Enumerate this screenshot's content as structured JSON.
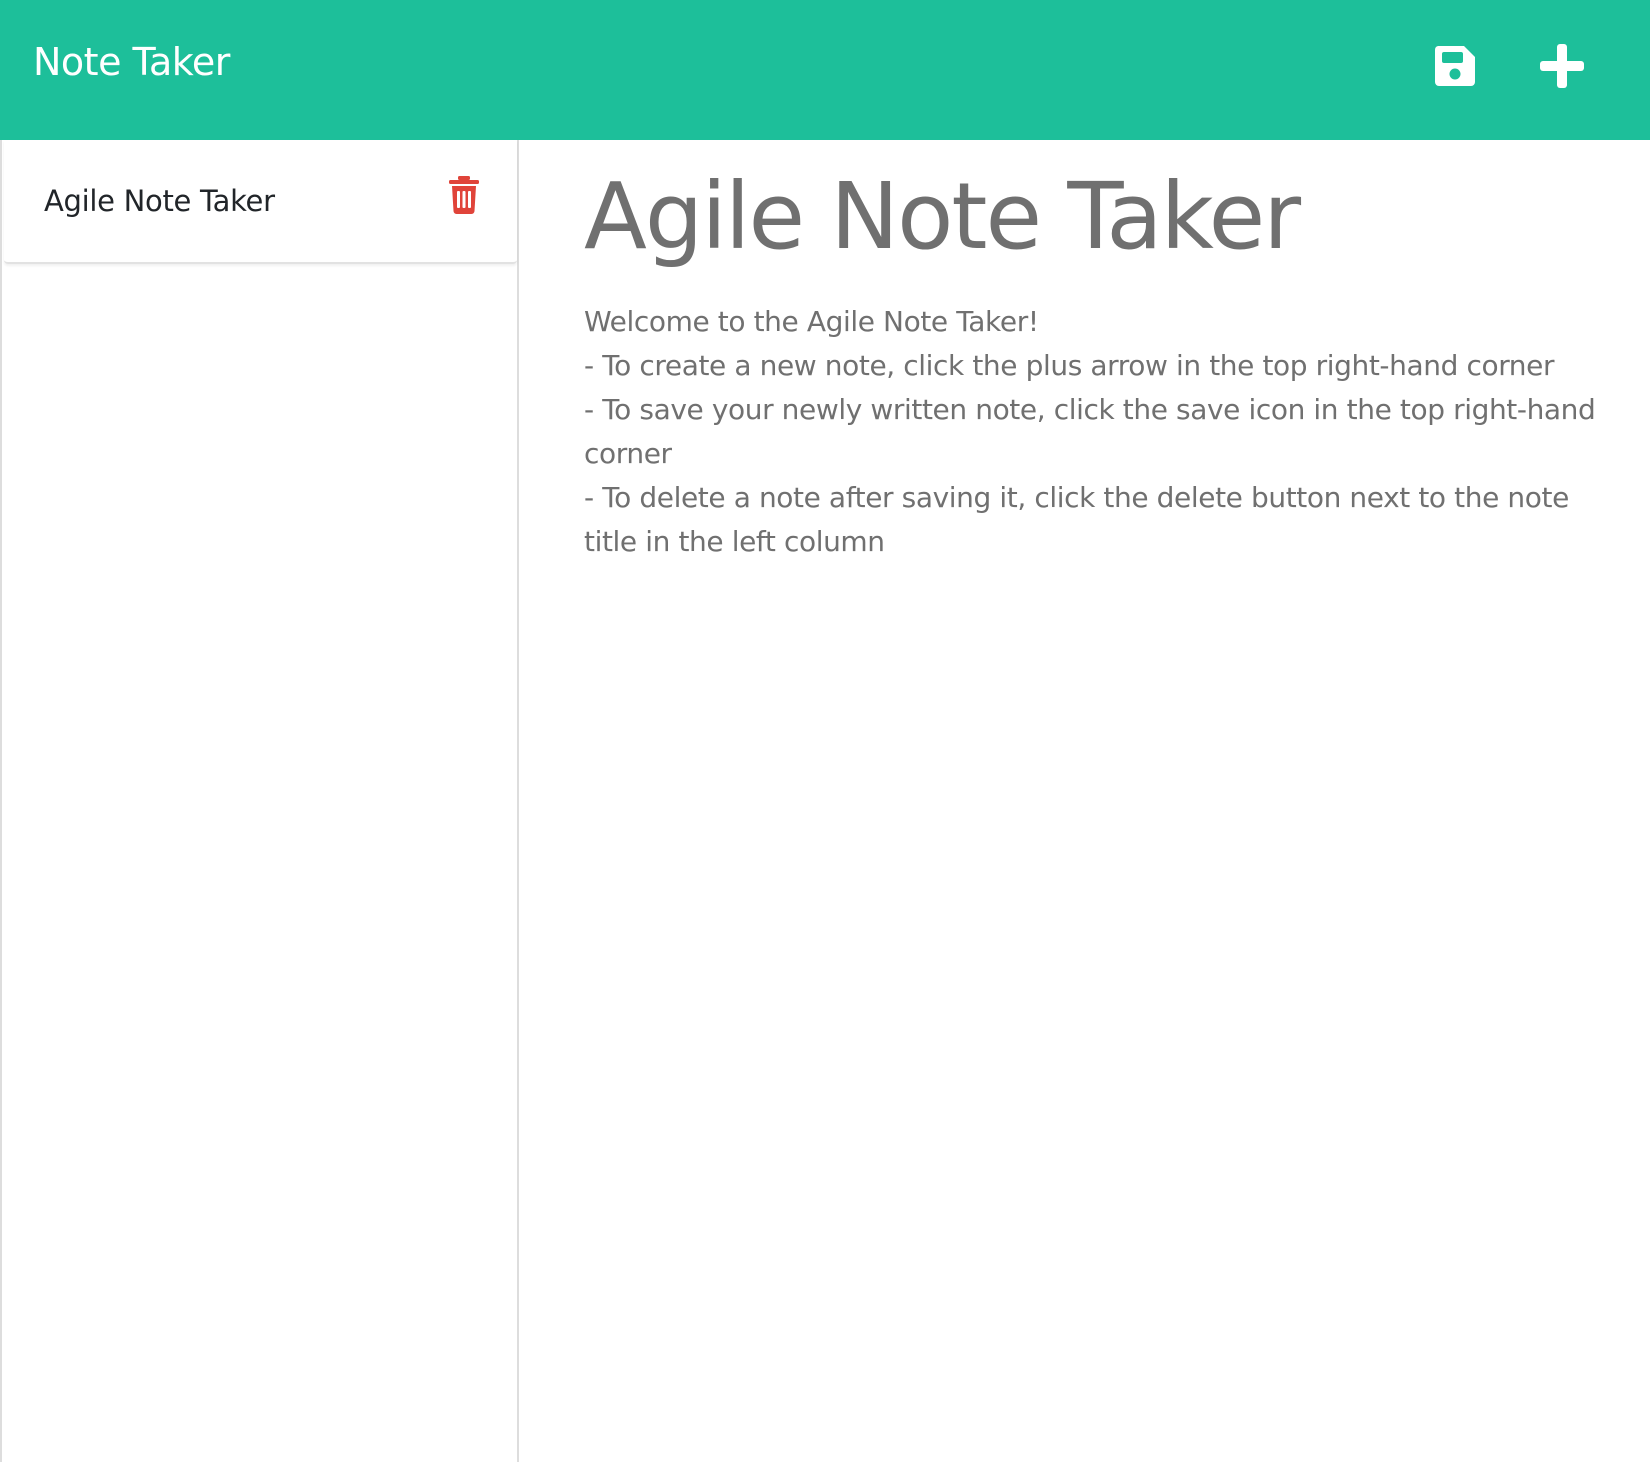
{
  "navbar": {
    "brand": "Note Taker",
    "background_color": "#1dbf9a",
    "icons": {
      "save": "save-icon",
      "new": "plus-icon"
    }
  },
  "sidebar": {
    "notes": [
      {
        "title": "Agile Note Taker",
        "delete_icon": "trash-icon",
        "delete_color": "#e0443a"
      }
    ]
  },
  "main": {
    "title": "Agile Note Taker",
    "text_lines": [
      "Welcome to the Agile Note Taker!",
      "- To create a new note, click the plus arrow in the top right-hand corner",
      "- To save your newly written note, click the save icon in the top right-hand corner",
      "- To delete a note after saving it, click the delete button next to the note title in the left column"
    ],
    "text_color": "#707070"
  }
}
